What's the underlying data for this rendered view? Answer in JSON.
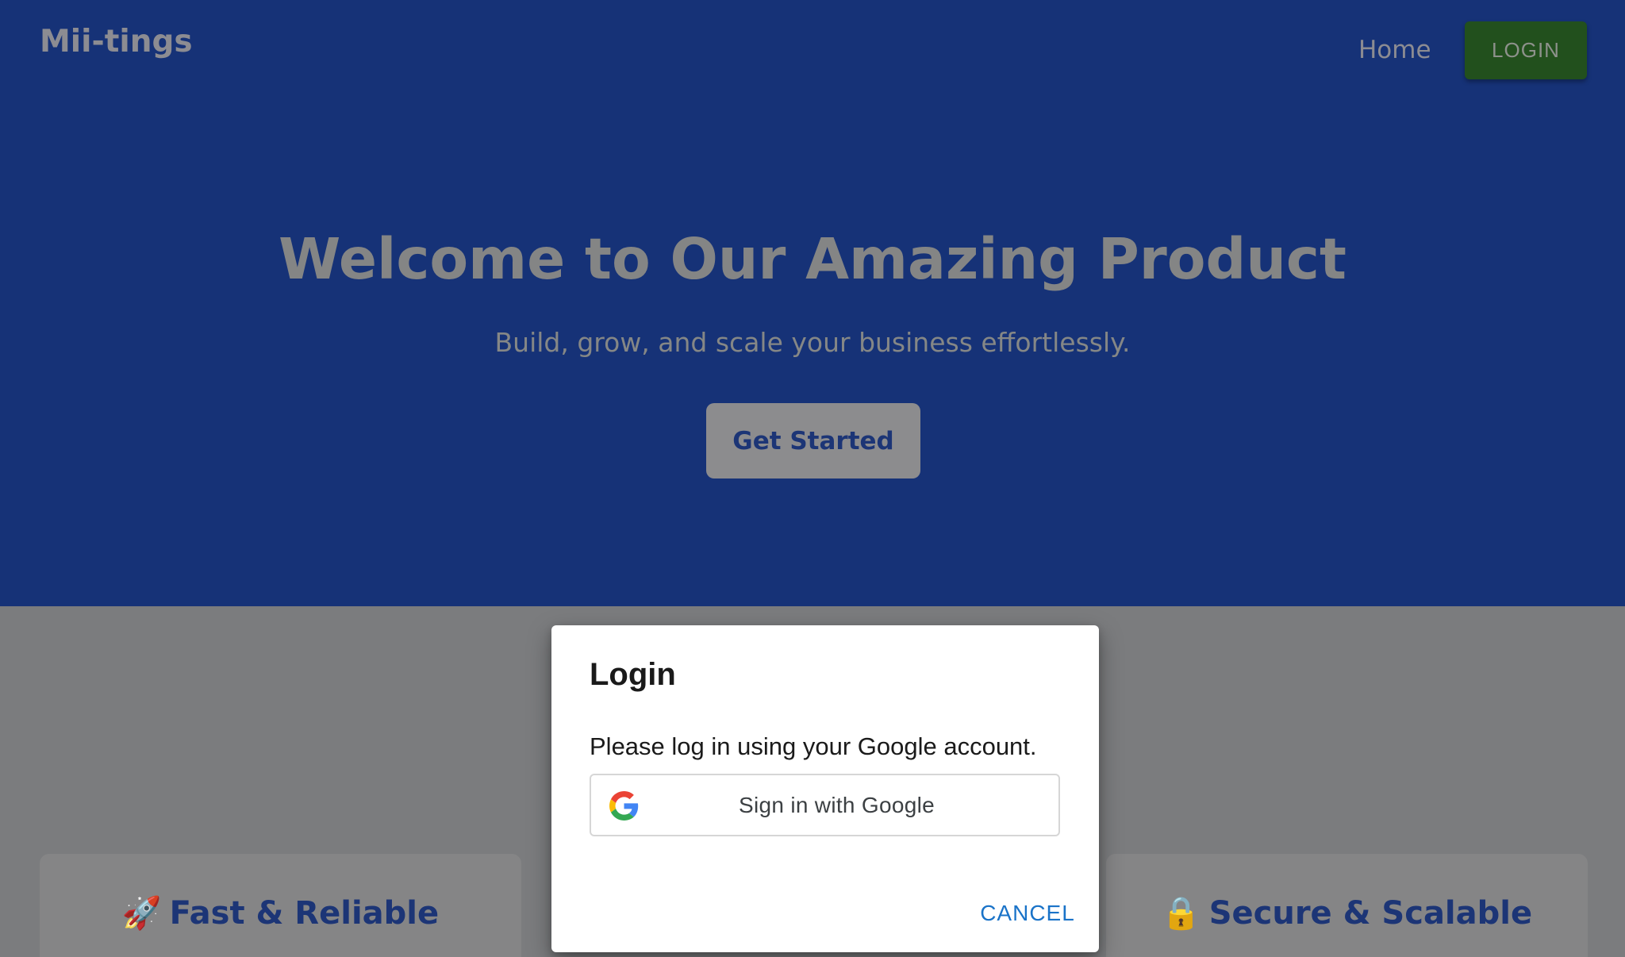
{
  "header": {
    "brand": "Mii-tings",
    "nav_home": "Home",
    "login_label": "LOGIN"
  },
  "hero": {
    "title": "Welcome to Our Amazing Product",
    "subtitle": "Build, grow, and scale your business effortlessly.",
    "cta_label": "Get Started"
  },
  "features": [
    {
      "emoji": "🚀",
      "title": "Fast & Reliable"
    },
    {
      "emoji": "🔒",
      "title": "Secure & Scalable"
    }
  ],
  "dialog": {
    "title": "Login",
    "message": "Please log in using your Google account.",
    "google_button_label": "Sign in with Google",
    "google_icon": "google-g-icon",
    "cancel_label": "CANCEL"
  },
  "colors": {
    "hero_background": "#163277",
    "login_button": "#22501d",
    "accent_blue": "#1c3576",
    "cancel_blue": "#1a73c8"
  }
}
